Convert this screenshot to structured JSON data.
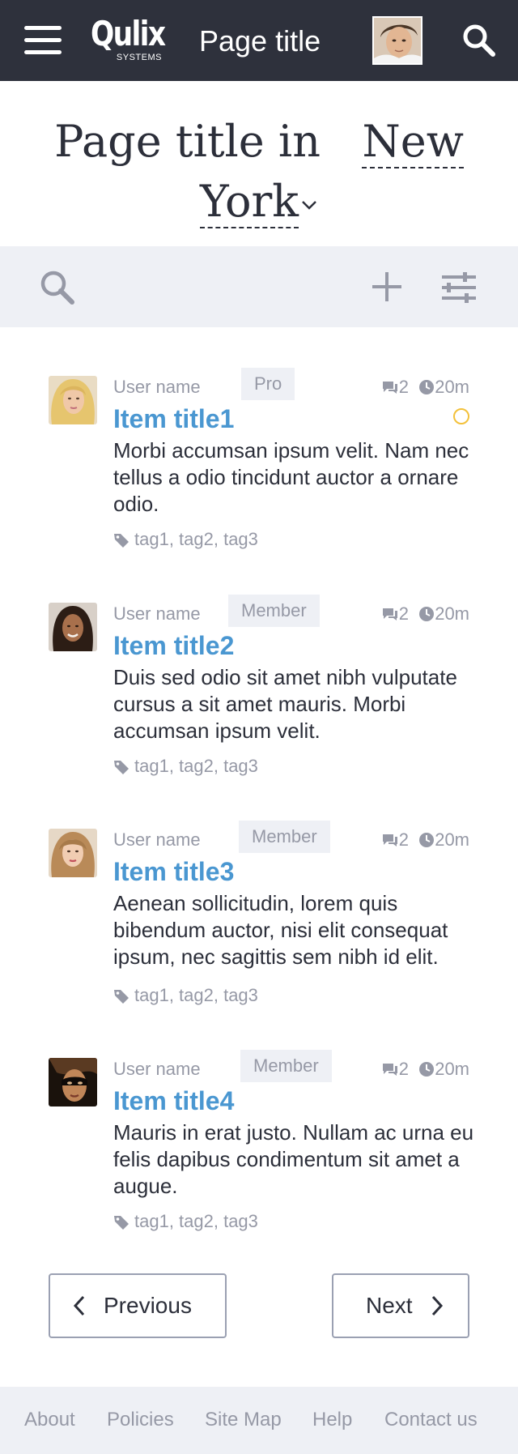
{
  "header": {
    "logo_word": "Qulix",
    "logo_sub": "SYSTEMS",
    "title": "Page title"
  },
  "heading": {
    "prefix": "Page title in",
    "city_first": "New",
    "city_second": "York"
  },
  "items": [
    {
      "user": "User name",
      "badge": "Pro",
      "comments": "2",
      "time": "20m",
      "title": "Item title1",
      "text": "Morbi accumsan ipsum velit. Nam nec tellus a odio tincidunt auctor a ornare odio.",
      "tags": "tag1, tag2, tag3",
      "status": "unread"
    },
    {
      "user": "User name",
      "badge": "Member",
      "comments": "2",
      "time": "20m",
      "title": "Item title2",
      "text": "Duis sed odio sit amet nibh vulputate cursus a sit amet mauris. Morbi accumsan ipsum velit.",
      "tags": "tag1, tag2, tag3"
    },
    {
      "user": "User name",
      "badge": "Member",
      "comments": "2",
      "time": "20m",
      "title": "Item title3",
      "text": "Aenean sollicitudin, lorem quis bibendum auctor, nisi elit consequat ipsum, nec sagittis sem nibh id elit.",
      "tags": "tag1, tag2, tag3"
    },
    {
      "user": "User name",
      "badge": "Member",
      "comments": "2",
      "time": "20m",
      "title": "Item title4",
      "text": "Mauris in erat justo. Nullam ac urna eu felis dapibus condimentum sit amet a augue.",
      "tags": "tag1, tag2, tag3"
    }
  ],
  "pagination": {
    "prev": "Previous",
    "next": "Next"
  },
  "footer": {
    "links": [
      "About",
      "Policies",
      "Site Map",
      "Help",
      "Contact us"
    ]
  },
  "colors": {
    "header_bg": "#2e313c",
    "accent": "#4a97d1",
    "muted": "#9699a6",
    "panel_bg": "#eef0f5",
    "status_ring": "#f3c13a"
  },
  "icons": [
    "menu-icon",
    "search-icon",
    "plus-icon",
    "filter-sliders-icon",
    "comment-icon",
    "clock-icon",
    "tag-icon",
    "chevron-down-icon",
    "chevron-left-icon",
    "chevron-right-icon"
  ]
}
